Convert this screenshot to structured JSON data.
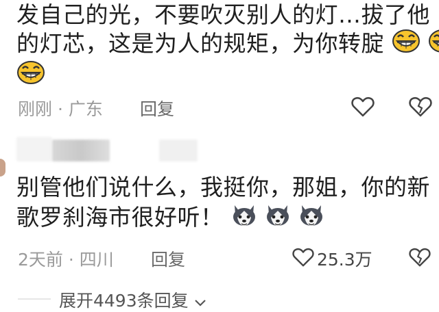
{
  "comment1": {
    "lines": [
      "发自己的光，不要吹灭别人的灯…拔了他",
      "的灯芯，这是为人的规矩，为你转腚"
    ],
    "emoji_name": "grinning-face-icon",
    "meta": "刚刚 · 广东",
    "reply_label": "回复"
  },
  "comment2": {
    "lines": [
      "别管他们说什么，我挺你，那姐，你的新",
      "歌罗刹海市很好听！"
    ],
    "emoji_name": "husky-dog-icon",
    "meta": "2天前 · 四川",
    "reply_label": "回复",
    "like_count": "25.3万"
  },
  "expand_replies": {
    "label": "展开4493条回复"
  },
  "colors": {
    "text": "#1f1f1f",
    "meta": "#9a9a9a",
    "icon": "#444444",
    "emoji_yellow": "#f7c42d"
  }
}
